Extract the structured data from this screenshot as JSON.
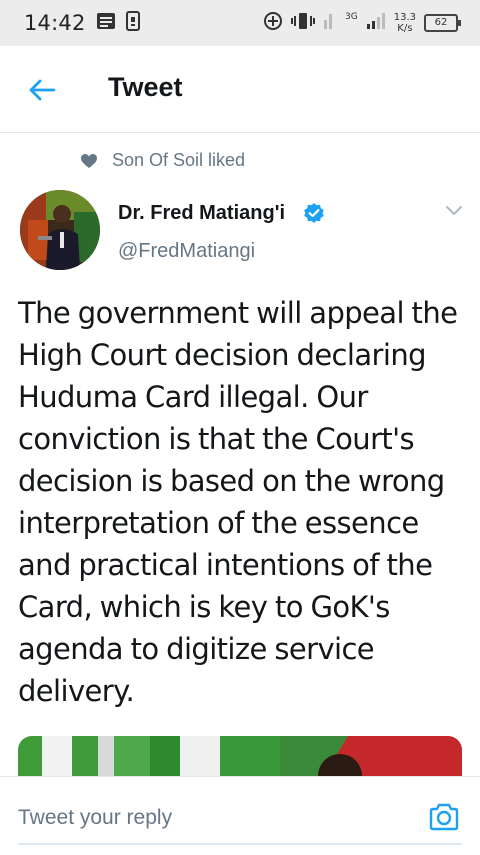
{
  "status_bar": {
    "time": "14:42",
    "net_type": "3G",
    "net_speed_value": "13.3",
    "net_speed_unit": "K/s",
    "battery_level": "62",
    "icons": [
      "message-icon",
      "sim-icon",
      "data-saver-icon",
      "vibrate-icon",
      "signal-icon",
      "battery-icon"
    ]
  },
  "header": {
    "title": "Tweet",
    "back_icon": "back-arrow-icon"
  },
  "social_context": {
    "text": "Son Of Soil liked",
    "icon": "heart-icon"
  },
  "tweet": {
    "author_name": "Dr. Fred Matiang'i",
    "author_handle": "@FredMatiangi",
    "verified": true,
    "text": "The government will appeal the High Court decision declaring Huduma Card illegal. Our conviction is that the Court's decision is based on the wrong interpretation of the essence and practical intentions of the Card, which is key to GoK's agenda to digitize service delivery."
  },
  "reply_bar": {
    "placeholder": "Tweet your reply",
    "camera_icon": "camera-icon"
  },
  "colors": {
    "accent": "#1da1f2",
    "text_primary": "#14171a",
    "text_secondary": "#657786",
    "divider": "#e1e8ed",
    "status_bar_bg": "#ececec"
  }
}
